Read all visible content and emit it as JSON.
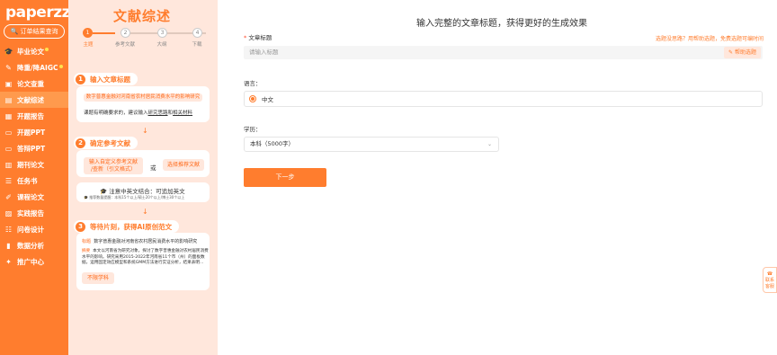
{
  "sidebar": {
    "logo": "paperzz",
    "order_query": "订单结果查询",
    "items": [
      {
        "label": "毕业论文",
        "icon": "graduation-cap-icon"
      },
      {
        "label": "降重/降AIGC",
        "icon": "rewrite-icon"
      },
      {
        "label": "论文查重",
        "icon": "check-icon"
      },
      {
        "label": "文献综述",
        "icon": "book-icon"
      },
      {
        "label": "开题报告",
        "icon": "report-icon"
      },
      {
        "label": "开题PPT",
        "icon": "slides-icon"
      },
      {
        "label": "答辩PPT",
        "icon": "slides-icon"
      },
      {
        "label": "期刊论文",
        "icon": "journal-icon"
      },
      {
        "label": "任务书",
        "icon": "task-icon"
      },
      {
        "label": "课程论文",
        "icon": "course-icon"
      },
      {
        "label": "实践报告",
        "icon": "practice-icon"
      },
      {
        "label": "问卷设计",
        "icon": "survey-icon"
      },
      {
        "label": "数据分析",
        "icon": "chart-icon"
      },
      {
        "label": "推广中心",
        "icon": "promo-icon"
      }
    ]
  },
  "guide": {
    "title": "文献综述",
    "steps": [
      "1",
      "2",
      "3",
      "4"
    ],
    "step_labels": [
      "主题",
      "参考文献",
      "大纲",
      "下载"
    ],
    "section1": {
      "num": "1",
      "title": "输入文章标题",
      "example": "数字普惠金融对河南省农村居民消费水平的影响研究",
      "note_prefix": "课题有明确要求的，建议输入",
      "note_link1": "研究思路",
      "note_mid": "和",
      "note_link2": "相关材料"
    },
    "section2": {
      "num": "2",
      "title": "确定参考文献",
      "btn_custom_l1": "输入自定义参考文献",
      "btn_custom_l2": "/查新（引文格式）",
      "or": "或",
      "btn_recommend": "选择推荐文献",
      "tip": "注意中英文结合：可追加英文",
      "tip_sub": "推荐数量提醒：本科15个以上/硕士20个以上/博士30个以上"
    },
    "section3": {
      "num": "3",
      "title": "等待片刻，获得AI原创范文",
      "label_title": "标题",
      "sample_title": "数字普惠金融对河南省农村居民消费水平的影响研究",
      "label_abstract": "摘要",
      "abstract_l1": "本文以河南省为研究对象，探讨了数字普惠金融对农村居民消费",
      "abstract_l2": "水平的影响。研究采用2015-2022年河南省11个市（州）的面板数",
      "abstract_l3": "据，运用固定效应模型和系统GMM方法进行实证分析，结果表明…",
      "tag": "不限学科"
    }
  },
  "main": {
    "heading": "输入完整的文章标题，获得更好的生成效果",
    "title_label": "文章标题",
    "title_hint": "选题没思路？用帮助选题，免费选题可编时间",
    "title_placeholder": "请输入标题",
    "help_button": "帮助选题",
    "lang_label": "语言：",
    "lang_value": "中文",
    "degree_label": "学历：",
    "degree_value": "本科（5000字）",
    "next_button": "下一步",
    "float_label": "联系客服"
  },
  "colors": {
    "accent": "#ff7d2e",
    "guide_bg": "#ffe7dc"
  }
}
